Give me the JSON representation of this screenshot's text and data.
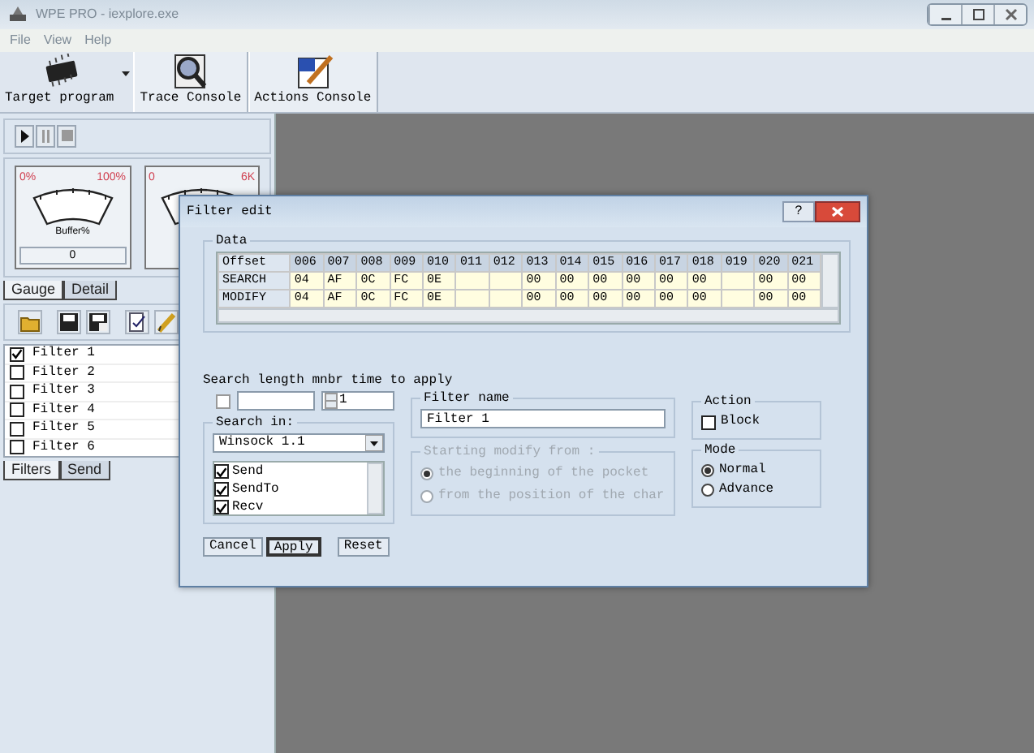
{
  "window": {
    "title": "WPE PRO - iexplore.exe"
  },
  "menu": [
    {
      "label": "File"
    },
    {
      "label": "View"
    },
    {
      "label": "Help"
    }
  ],
  "toolbar": [
    {
      "label": "Target program",
      "kind": "chip",
      "dropdown": true
    },
    {
      "label": "Trace Console",
      "kind": "trace",
      "dropdown": false
    },
    {
      "label": "Actions Console",
      "kind": "actions",
      "dropdown": false
    }
  ],
  "gauges": [
    {
      "min": "0%",
      "max": "100%",
      "caption": "Buffer%",
      "value": "0"
    },
    {
      "min": "0",
      "max": "6K"
    }
  ],
  "gauge_tabs": [
    {
      "label": "Gauge",
      "selected": true
    },
    {
      "label": "Detail",
      "selected": false
    }
  ],
  "filters": [
    {
      "label": "Filter 1",
      "checked": true
    },
    {
      "label": "Filter 2",
      "checked": false
    },
    {
      "label": "Filter 3",
      "checked": false
    },
    {
      "label": "Filter 4",
      "checked": false
    },
    {
      "label": "Filter 5",
      "checked": false
    },
    {
      "label": "Filter 6",
      "checked": false
    }
  ],
  "filter_tabs": [
    {
      "label": "Filters",
      "selected": true
    },
    {
      "label": "Send",
      "selected": false
    }
  ],
  "dialog": {
    "title": "Filter edit",
    "help": "?",
    "data": {
      "label": "Data",
      "columns": [
        "Offset",
        "006",
        "007",
        "008",
        "009",
        "010",
        "011",
        "012",
        "013",
        "014",
        "015",
        "016",
        "017",
        "018",
        "019",
        "020",
        "021"
      ],
      "rows": [
        {
          "cells": [
            "SEARCH",
            "04",
            "AF",
            "0C",
            "FC",
            "0E",
            "",
            "",
            "00",
            "00",
            "00",
            "00",
            "00",
            "00",
            "",
            "00",
            "00"
          ]
        },
        {
          "cells": [
            "MODIFY",
            "04",
            "AF",
            "0C",
            "FC",
            "0E",
            "",
            "",
            "00",
            "00",
            "00",
            "00",
            "00",
            "00",
            "",
            "00",
            "00"
          ]
        }
      ]
    },
    "search_length": {
      "label": "Search length mnbr time to apply",
      "checked": false,
      "spin_value": "1"
    },
    "filter_name": {
      "label": "Filter name",
      "value": "Filter 1"
    },
    "search_in": {
      "label": "Search in:",
      "protocol": "Winsock 1.1",
      "items": [
        {
          "label": "Send",
          "checked": true
        },
        {
          "label": "SendTo",
          "checked": true
        },
        {
          "label": "Recv",
          "checked": true
        }
      ]
    },
    "start_modify": {
      "label": "Starting modify from :",
      "disabled": true,
      "options": [
        {
          "label": "the beginning of the pocket",
          "selected": true
        },
        {
          "label": "from the position of the char",
          "selected": false
        }
      ]
    },
    "action": {
      "label": "Action",
      "block": {
        "label": "Block",
        "checked": false
      }
    },
    "mode": {
      "label": "Mode",
      "options": [
        {
          "label": "Normal",
          "selected": true
        },
        {
          "label": "Advance",
          "selected": false
        }
      ]
    },
    "buttons": [
      {
        "label": "Cancel",
        "default": false
      },
      {
        "label": "Apply",
        "default": true
      },
      {
        "label": "Reset",
        "default": false
      }
    ]
  }
}
